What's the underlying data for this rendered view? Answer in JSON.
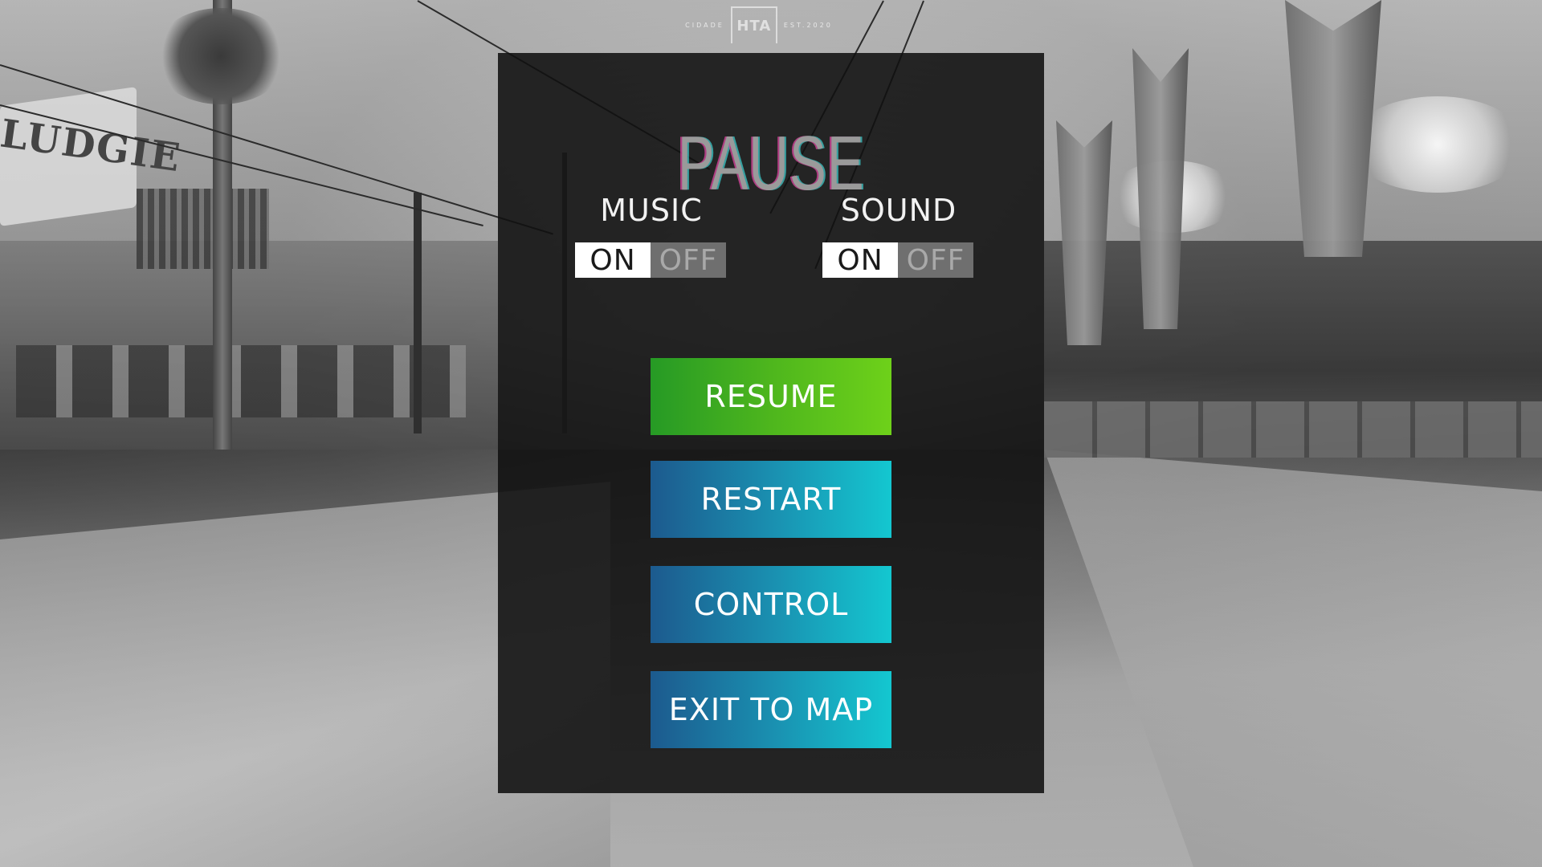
{
  "logo": {
    "left_text": "CIDADE",
    "emblem_text": "HTA",
    "right_text": "EST.2020"
  },
  "pause_menu": {
    "title": "PAUSE",
    "music": {
      "label": "MUSIC",
      "on_label": "ON",
      "off_label": "OFF",
      "selected": "ON"
    },
    "sound": {
      "label": "SOUND",
      "on_label": "ON",
      "off_label": "OFF",
      "selected": "ON"
    },
    "buttons": {
      "resume": "RESUME",
      "restart": "RESTART",
      "control": "CONTROL",
      "exit": "EXIT TO MAP"
    }
  },
  "background": {
    "sign_text": "LUDGIE"
  },
  "colors": {
    "panel": "#101010",
    "resume_gradient": [
      "#269a25",
      "#6ed11a"
    ],
    "button_gradient": [
      "#1c5a8e",
      "#14c7d0"
    ],
    "toggle_on": "#ffffff",
    "toggle_off": "#6f6f6f"
  }
}
